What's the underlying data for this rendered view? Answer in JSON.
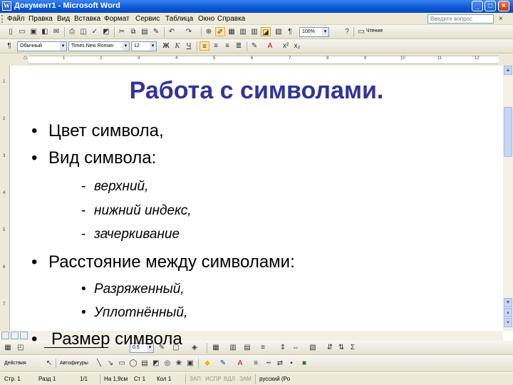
{
  "window": {
    "title": "Документ1 - Microsoft Word",
    "minimize": "_",
    "maximize": "□",
    "close": "×"
  },
  "menu": {
    "items": [
      "Файл",
      "Правка",
      "Вид",
      "Вставка",
      "Формат",
      "Сервис",
      "Таблица",
      "Окно",
      "Справка"
    ],
    "help_placeholder": "Введите вопрос",
    "doc_close": "×"
  },
  "standard_toolbar": {
    "zoom": "100%",
    "reading_label": "Чтение"
  },
  "format_toolbar": {
    "style": "Обычный",
    "font": "Times New Roman",
    "size": "12",
    "bold": "Ж",
    "italic": "К",
    "underline": "Ч",
    "font_color_glyph": "A"
  },
  "ruler": {
    "ticks": [
      "1",
      "2",
      "3",
      "4",
      "5",
      "6",
      "7",
      "8",
      "9",
      "10",
      "11",
      "12"
    ]
  },
  "document": {
    "title": "Работа с символами.",
    "bullets": [
      "Цвет символа,",
      "Вид символа:"
    ],
    "sub_dashes": [
      "верхний,",
      "нижний индекс,",
      "зачеркивание"
    ],
    "bullet3": "Расстояние между символами:",
    "sub_bullets": [
      "Разряженный,",
      "Уплотнённый,"
    ],
    "bullet4": "Размер символа",
    "bullet_glyph": "•",
    "dash_glyph": "-"
  },
  "drawing_toolbar": {
    "line_width": "0,5",
    "actions_label": "Действия",
    "autoshapes_label": "Автофигуры"
  },
  "status_bar": {
    "page": "Стр. 1",
    "section": "Разд 1",
    "pages": "1/1",
    "position": "На 1,9см",
    "line": "Ст 1",
    "column": "Кол 1",
    "rec": "ЗАП",
    "trk": "ИСПР",
    "ext": "ВДЛ",
    "ovr": "ЗАМ",
    "language": "русский (Ро"
  },
  "colors": {
    "title_color": "#333399",
    "titlebar": "#0a57d6",
    "chrome": "#ece9d8"
  }
}
